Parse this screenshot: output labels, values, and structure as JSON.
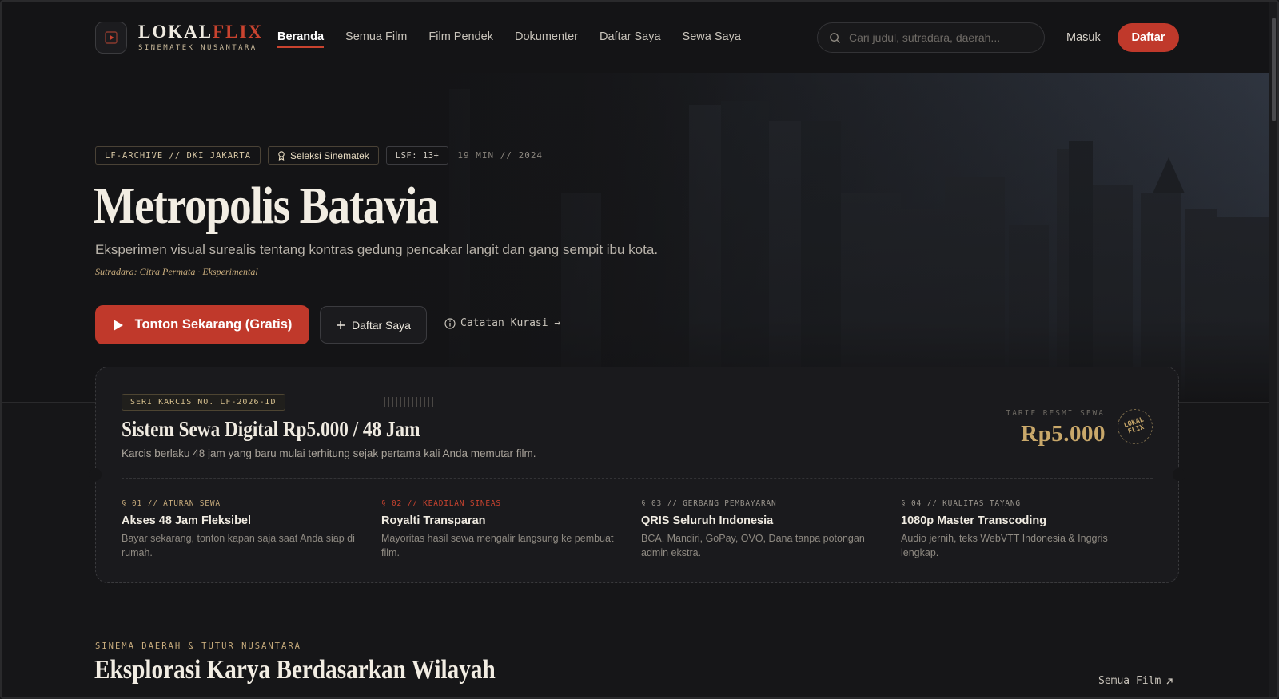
{
  "brand": {
    "name_main": "LOKAL",
    "name_accent": "FLIX",
    "subtitle": "SINEMATEK NUSANTARA",
    "accent_color": "#c0392b"
  },
  "nav": {
    "items": [
      {
        "label": "Beranda",
        "active": true
      },
      {
        "label": "Semua Film",
        "active": false
      },
      {
        "label": "Film Pendek",
        "active": false
      },
      {
        "label": "Dokumenter",
        "active": false
      },
      {
        "label": "Daftar Saya",
        "active": false
      },
      {
        "label": "Sewa Saya",
        "active": false
      }
    ]
  },
  "search": {
    "placeholder": "Cari judul, sutradara, daerah...",
    "icon": "search-icon"
  },
  "auth": {
    "login_label": "Masuk",
    "register_label": "Daftar"
  },
  "hero": {
    "archive_tag": "LF-ARCHIVE // DKI JAKARTA",
    "selection_tag": "Seleksi Sinematek",
    "rating_tag": "LSF: 13+",
    "duration_year": "19 MIN // 2024",
    "title": "Metropolis Batavia",
    "description": "Eksperimen visual surealis tentang kontras gedung pencakar langit dan gang sempit ibu kota.",
    "director": "Sutradara: Citra Permata · Eksperimental",
    "watch_label": "Tonton Sekarang (Gratis)",
    "list_label": "Daftar Saya",
    "curation_label": "Catatan Kurasi →"
  },
  "ticket": {
    "serial": "SERI KARCIS NO. LF-2026-ID",
    "title": "Sistem Sewa Digital Rp5.000 / 48 Jam",
    "subtitle": "Karcis berlaku 48 jam yang baru mulai terhitung sejak pertama kali Anda memutar film.",
    "price_label": "TARIF RESMI SEWA",
    "price": "Rp5.000",
    "stamp_line1": "LOKAL",
    "stamp_line2": "FLIX",
    "features": [
      {
        "kicker": "§ 01 // ATURAN SEWA",
        "title": "Akses 48 Jam Fleksibel",
        "desc": "Bayar sekarang, tonton kapan saja saat Anda siap di rumah."
      },
      {
        "kicker": "§ 02 // KEADILAN SINEAS",
        "title": "Royalti Transparan",
        "desc": "Mayoritas hasil sewa mengalir langsung ke pembuat film."
      },
      {
        "kicker": "§ 03 // GERBANG PEMBAYARAN",
        "title": "QRIS Seluruh Indonesia",
        "desc": "BCA, Mandiri, GoPay, OVO, Dana tanpa potongan admin ekstra."
      },
      {
        "kicker": "§ 04 // KUALITAS TAYANG",
        "title": "1080p Master Transcoding",
        "desc": "Audio jernih, teks WebVTT Indonesia & Inggris lengkap."
      }
    ]
  },
  "section": {
    "kicker": "SINEMA DAERAH & TUTUR NUSANTARA",
    "title": "Eksplorasi Karya Berdasarkan Wilayah",
    "link_label": "Semua Film"
  }
}
